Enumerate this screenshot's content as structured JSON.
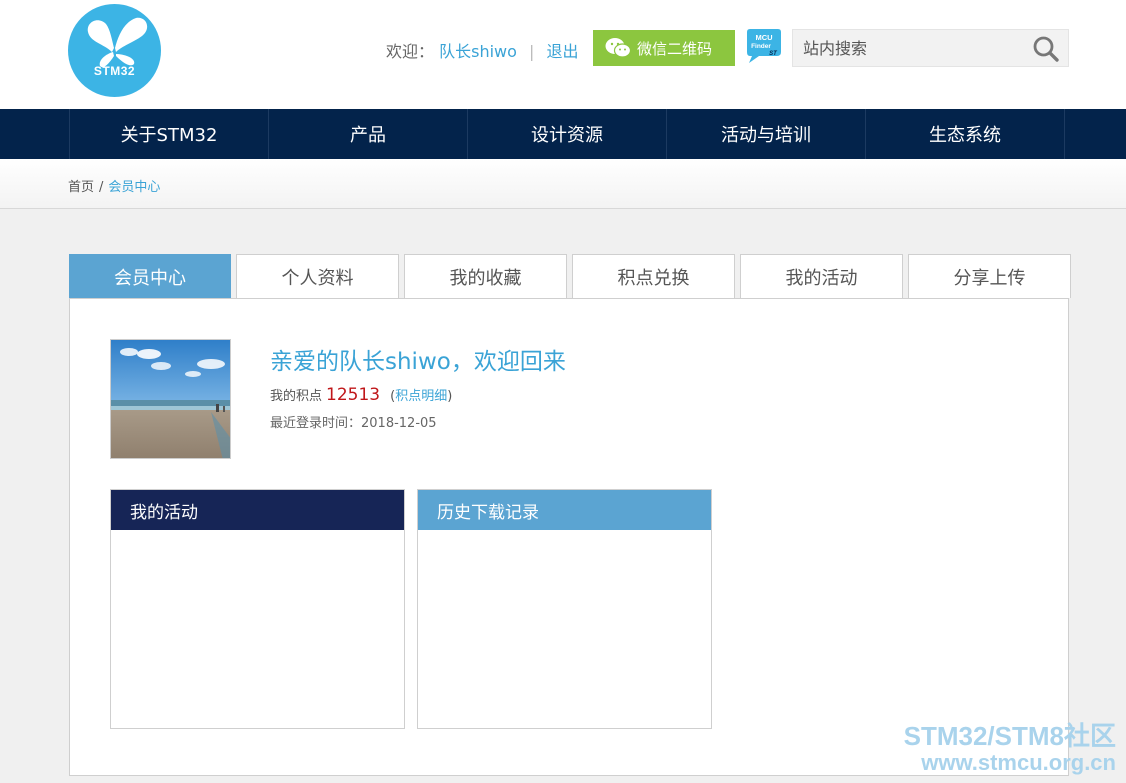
{
  "header": {
    "logo_text": "STM32",
    "welcome_label": "欢迎：",
    "username": "队长shiwo",
    "separator": "|",
    "logout_label": "退出",
    "wechat_label": "微信二维码",
    "mcu_finder_label": "MCU Finder",
    "search_placeholder": "站内搜索"
  },
  "nav": {
    "items": [
      "关于STM32",
      "产品",
      "设计资源",
      "活动与培训",
      "生态系统"
    ]
  },
  "breadcrumb": {
    "home": "首页",
    "separator": "/",
    "current": "会员中心"
  },
  "tabs": [
    {
      "label": "会员中心",
      "active": true
    },
    {
      "label": "个人资料",
      "active": false
    },
    {
      "label": "我的收藏",
      "active": false
    },
    {
      "label": "积点兑换",
      "active": false
    },
    {
      "label": "我的活动",
      "active": false
    },
    {
      "label": "分享上传",
      "active": false
    }
  ],
  "profile": {
    "greeting": "亲爱的队长shiwo，欢迎回来",
    "points_label": "我的积点",
    "points_value": "12513",
    "points_detail_open": "(",
    "points_detail": "积点明细",
    "points_detail_close": ")",
    "last_login": "最近登录时间：2018-12-05"
  },
  "boxes": {
    "activities_title": "我的活动",
    "downloads_title": "历史下载记录"
  },
  "watermark": {
    "line1": "STM32/STM8社区",
    "line2": "www.stmcu.org.cn"
  },
  "colors": {
    "nav_bg": "#03234b",
    "accent_blue": "#5ba4d2",
    "link_blue": "#3aa3d6",
    "wechat_green": "#8cc63f",
    "points_red": "#c0171a",
    "activities_head": "#162556"
  }
}
